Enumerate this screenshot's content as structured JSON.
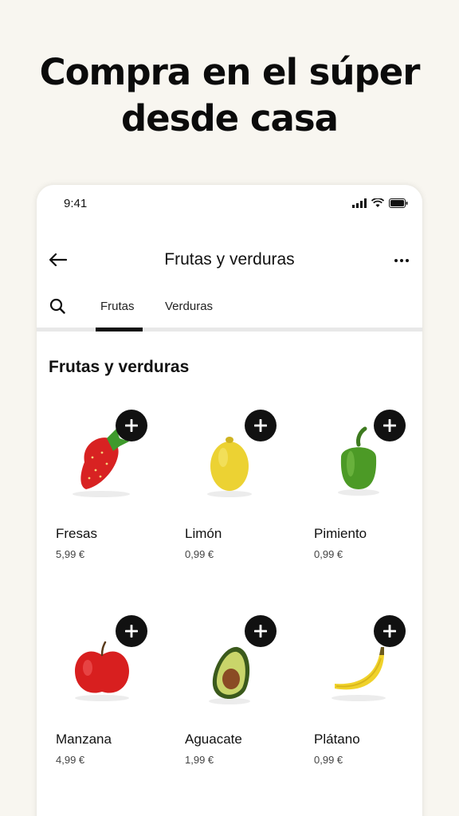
{
  "headline": {
    "line1": "Compra en el súper",
    "line2": "desde casa"
  },
  "status_bar": {
    "time": "9:41"
  },
  "nav": {
    "title": "Frutas y verduras"
  },
  "tabs": [
    {
      "label": "Frutas",
      "selected": true
    },
    {
      "label": "Verduras",
      "selected": false
    }
  ],
  "section": {
    "title": "Frutas y verduras"
  },
  "products": [
    {
      "name": "Fresas",
      "price": "5,99 €",
      "icon": "strawberry-icon"
    },
    {
      "name": "Limón",
      "price": "0,99 €",
      "icon": "lemon-icon"
    },
    {
      "name": "Pimiento",
      "price": "0,99 €",
      "icon": "pepper-icon"
    },
    {
      "name": "Manzana",
      "price": "4,99 €",
      "icon": "apple-icon"
    },
    {
      "name": "Aguacate",
      "price": "1,99 €",
      "icon": "avocado-icon"
    },
    {
      "name": "Plátano",
      "price": "0,99 €",
      "icon": "banana-icon"
    }
  ],
  "colors": {
    "background": "#f8f6f0",
    "accent": "#111111"
  }
}
